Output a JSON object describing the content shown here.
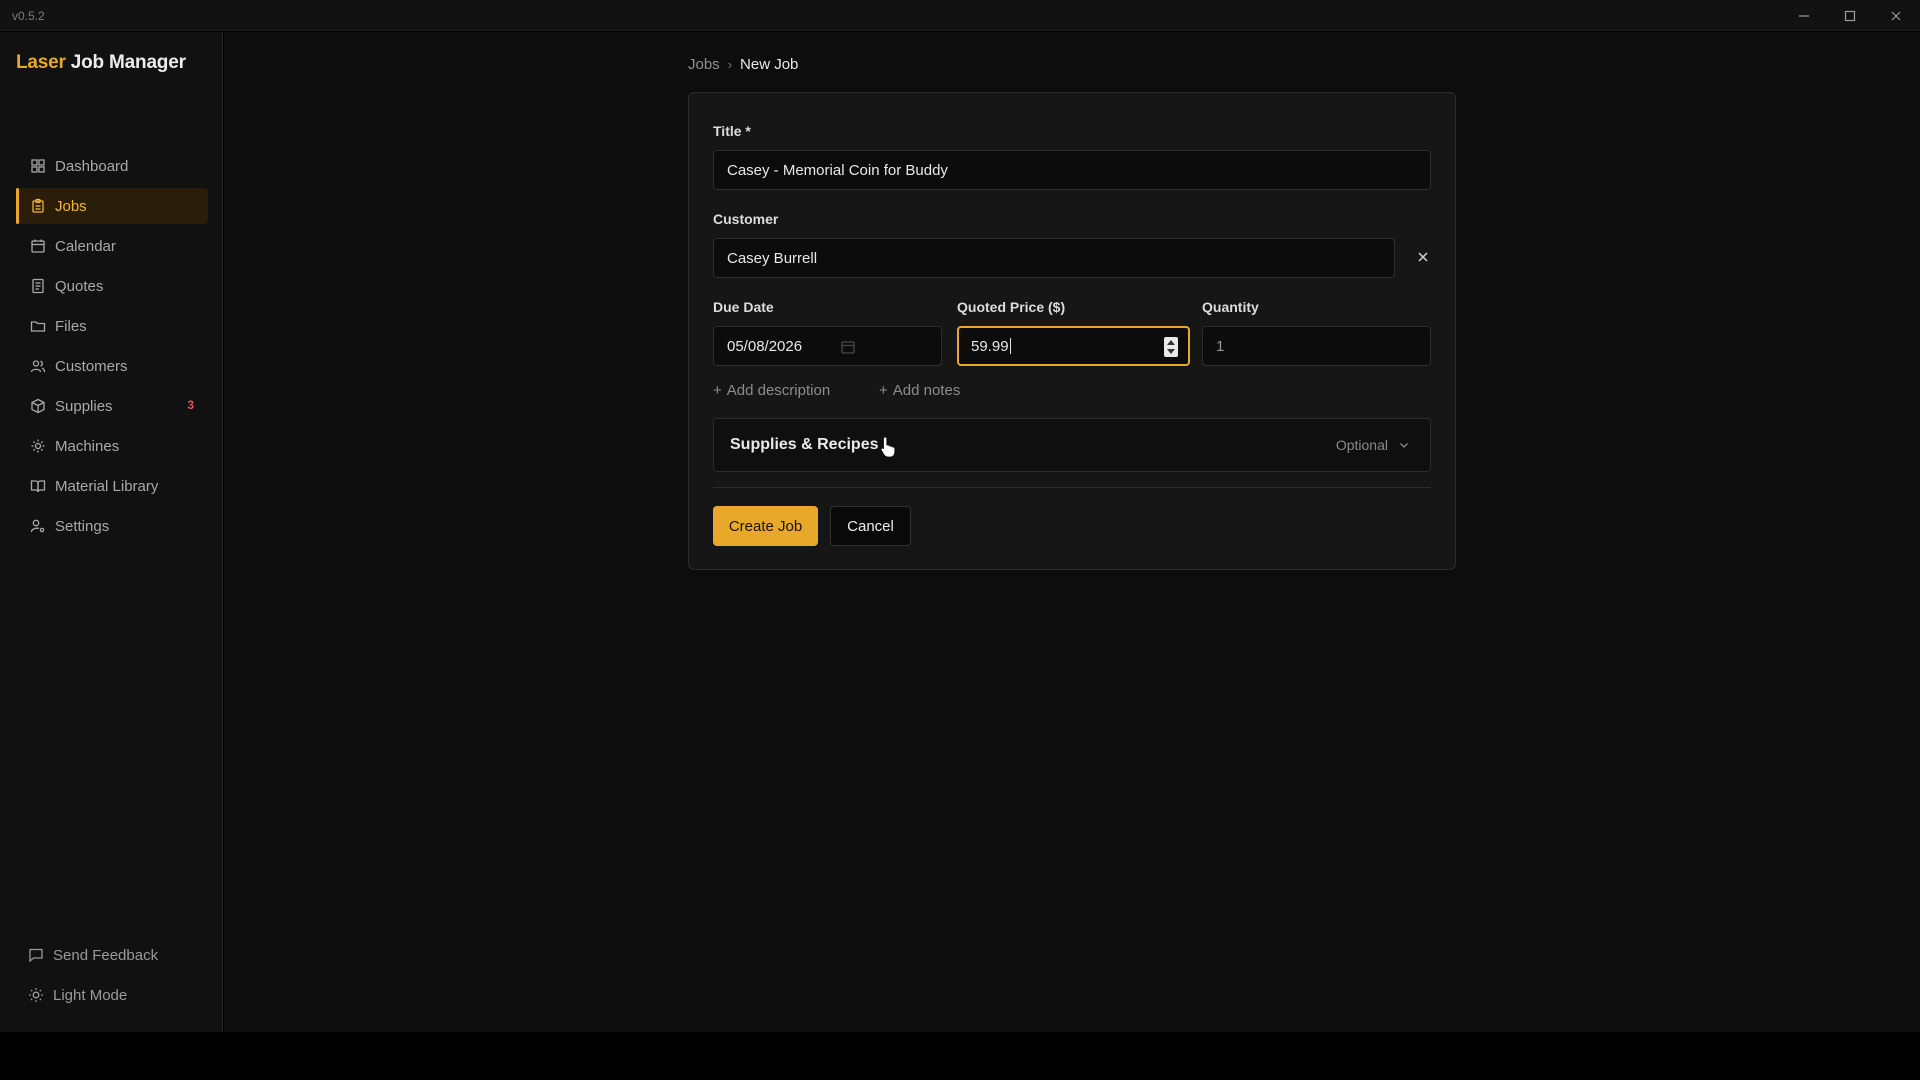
{
  "window": {
    "version": "v0.5.2",
    "controls": [
      "minimize-icon",
      "maximize-icon",
      "close-icon"
    ]
  },
  "sidebar": {
    "brand": {
      "accent": "Laser",
      "rest": " Job Manager"
    },
    "items": [
      {
        "label": "Dashboard",
        "icon": "dashboard-icon"
      },
      {
        "label": "Jobs",
        "icon": "clipboard-icon",
        "active": true
      },
      {
        "label": "Calendar",
        "icon": "calendar-icon"
      },
      {
        "label": "Quotes",
        "icon": "document-icon"
      },
      {
        "label": "Files",
        "icon": "folder-icon"
      },
      {
        "label": "Customers",
        "icon": "users-icon"
      },
      {
        "label": "Supplies",
        "icon": "package-icon",
        "badge": "3"
      },
      {
        "label": "Machines",
        "icon": "gear-icon"
      },
      {
        "label": "Material Library",
        "icon": "book-icon"
      },
      {
        "label": "Settings",
        "icon": "user-settings-icon"
      }
    ],
    "bottom": [
      {
        "label": "Send Feedback",
        "icon": "message-icon"
      },
      {
        "label": "Light Mode",
        "icon": "sun-icon"
      }
    ]
  },
  "breadcrumb": {
    "parent": "Jobs",
    "current": "New Job"
  },
  "form": {
    "title_label": "Title *",
    "title_value": "Casey - Memorial Coin for Buddy",
    "customer_label": "Customer",
    "customer_value": "Casey Burrell",
    "due_date_label": "Due Date",
    "due_date_value": "05/08/2026",
    "price_label": "Quoted Price ($)",
    "price_value": "59.99",
    "quantity_label": "Quantity",
    "quantity_value": "1",
    "add_description": "Add description",
    "add_notes": "Add notes",
    "supplies_title": "Supplies & Recipes",
    "supplies_optional": "Optional",
    "create_label": "Create Job",
    "cancel_label": "Cancel"
  },
  "colors": {
    "accent": "#e8a92a",
    "badge": "#e2554f",
    "background": "#0d0d0d",
    "card": "#161616"
  }
}
